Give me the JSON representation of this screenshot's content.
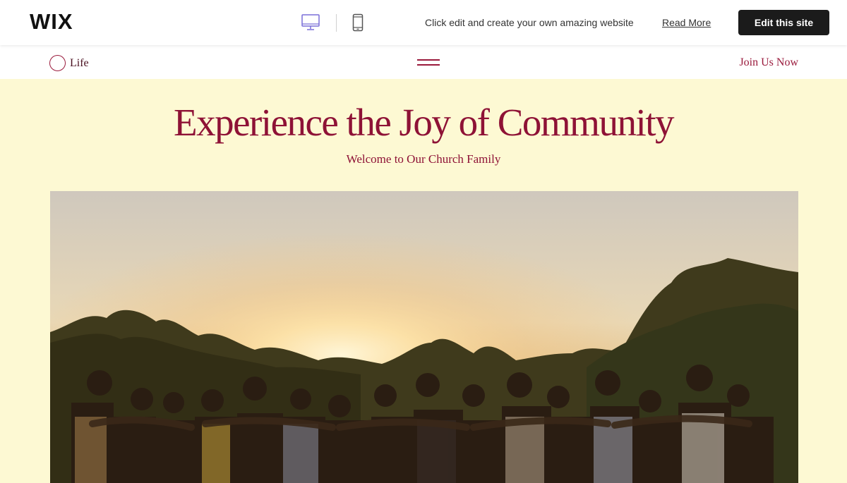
{
  "wix_bar": {
    "logo": "WIX",
    "promo_text": "Click edit and create your own amazing website",
    "read_more": "Read More",
    "edit_button": "Edit this site",
    "icons": [
      "desktop-icon",
      "mobile-icon"
    ],
    "desktop_active_color": "#7a6fd8"
  },
  "site_header": {
    "logo_text": "Life",
    "join_link": "Join Us Now"
  },
  "hero": {
    "title": "Experience the Joy of Community",
    "subtitle": "Welcome to Our Church Family",
    "photo": "people-embracing-at-sunset"
  },
  "colors": {
    "accent": "#8e1236",
    "hero_background": "#fdf9d3",
    "edit_button_bg": "#1b1b1b"
  }
}
